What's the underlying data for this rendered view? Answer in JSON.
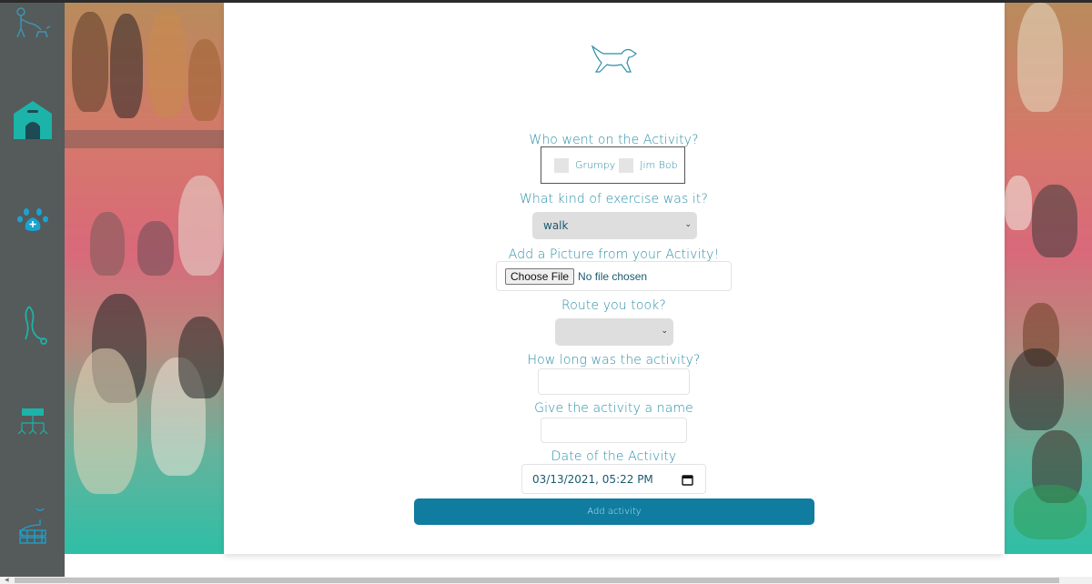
{
  "sidebar": {
    "items": [
      {
        "icon": "dog-walker-icon",
        "label": ""
      },
      {
        "icon": "dog-house-icon",
        "label": ""
      },
      {
        "icon": "paw-icon",
        "label": ""
      },
      {
        "icon": "leash-icon",
        "label": ""
      },
      {
        "icon": "hierarchy-icon",
        "label": ""
      },
      {
        "icon": "route-map-icon",
        "label": ""
      }
    ]
  },
  "form": {
    "logo_icon": "dog-logo-icon",
    "who_label": "Who went on the Activity?",
    "dogs": [
      {
        "name": "Grumpy",
        "checked": false
      },
      {
        "name": "Jim Bob",
        "checked": false
      }
    ],
    "exercise_label": "What kind of exercise was it?",
    "exercise_value": "walk",
    "picture_label": "Add a Picture from your Activity!",
    "file_button": "Choose File",
    "file_status": "No file chosen",
    "route_label": "Route you took?",
    "route_value": "",
    "duration_label": "How long was the activity?",
    "duration_value": "",
    "name_label": "Give the activity a name",
    "name_value": "",
    "date_label": "Date of the Activity",
    "date_value": "03/13/2021, 05:22 PM",
    "submit_label": "Add activity"
  },
  "colors": {
    "accent": "#2c8fa8",
    "button": "#0f7ca0",
    "sidebar_bg": "#555a5b",
    "sidebar_icon": "#1fb5a8"
  }
}
